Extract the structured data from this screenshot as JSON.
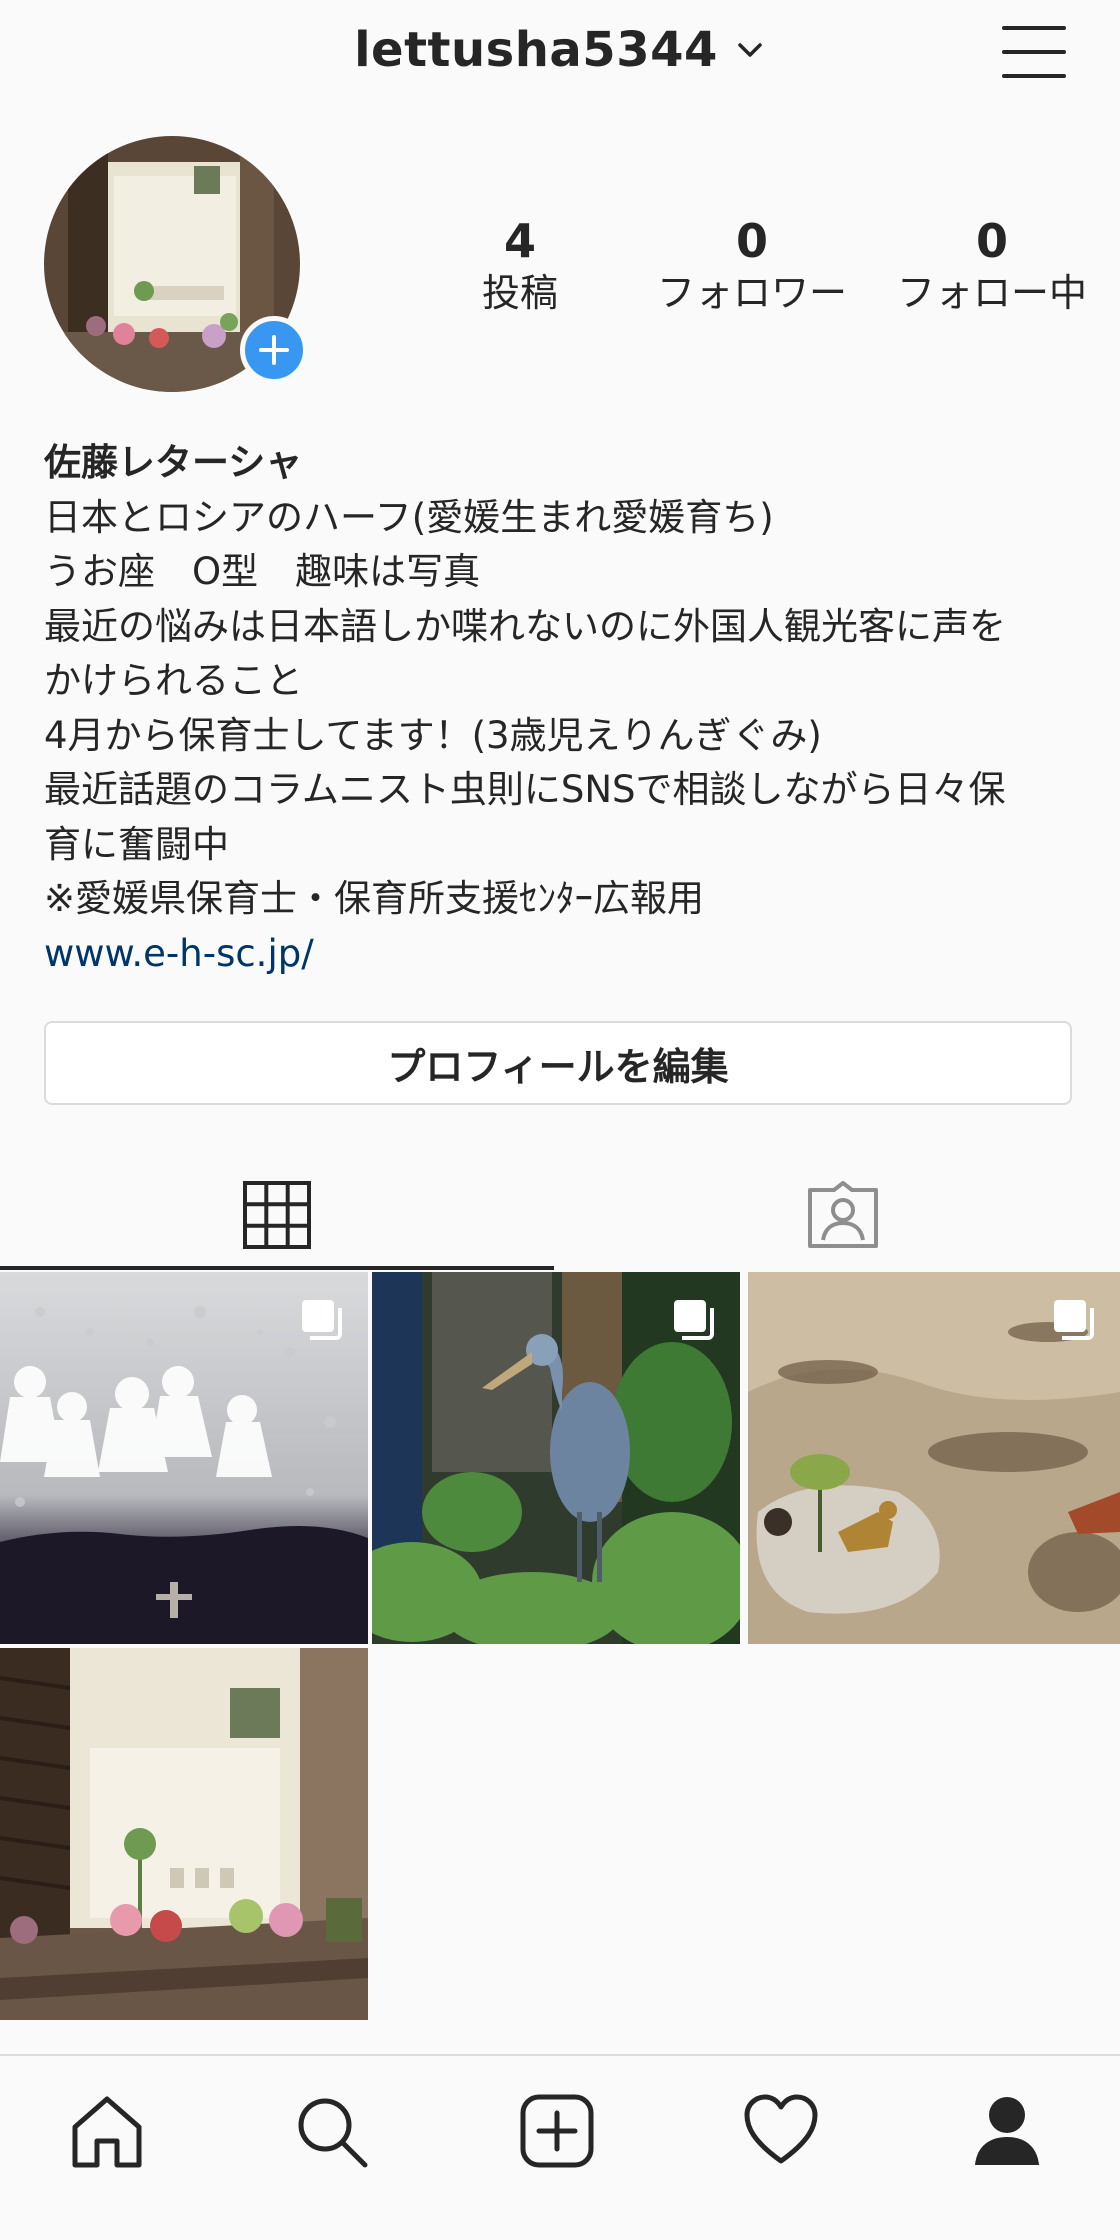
{
  "header": {
    "username": "lettusha5344",
    "menu_icon": "hamburger-menu-icon"
  },
  "profile": {
    "stats": [
      {
        "value": "4",
        "label": "投稿"
      },
      {
        "value": "0",
        "label": "フォロワー"
      },
      {
        "value": "0",
        "label": "フォロー中"
      }
    ],
    "display_name": "佐藤レターシャ",
    "bio_lines": [
      "日本とロシアのハーフ(愛媛生まれ愛媛育ち)",
      "うお座　O型　趣味は写真",
      "最近の悩みは日本語しか喋れないのに外国人観光客に声を",
      "かけられること",
      "4月から保育士してます！(3歳児えりんぎぐみ)",
      "最近話題のコラムニスト虫則にSNSで相談しながら日々保",
      "育に奮闘中",
      "※愛媛県保育士・保育所支援ｾﾝﾀｰ広報用"
    ],
    "website": "www.e-h-sc.jp/",
    "edit_button": "プロフィールを編集"
  },
  "tabs": [
    {
      "icon": "grid-icon",
      "active": true
    },
    {
      "icon": "tagged-person-icon",
      "active": false
    }
  ],
  "posts": [
    {
      "subject": "teru-teru-bozu rain window",
      "multi": true
    },
    {
      "subject": "shoebill bird in greenery",
      "multi": true
    },
    {
      "subject": "toy dinosaurs in puddle",
      "multi": true
    },
    {
      "subject": "window with flower pots",
      "multi": false
    }
  ],
  "bottom_nav": [
    {
      "icon": "home-icon"
    },
    {
      "icon": "search-icon"
    },
    {
      "icon": "new-post-icon"
    },
    {
      "icon": "activity-heart-icon"
    },
    {
      "icon": "profile-icon"
    }
  ],
  "colors": {
    "background": "#fafafa",
    "text": "#262626",
    "link": "#003569",
    "accent": "#3897f0",
    "border": "#dbdbdb"
  }
}
